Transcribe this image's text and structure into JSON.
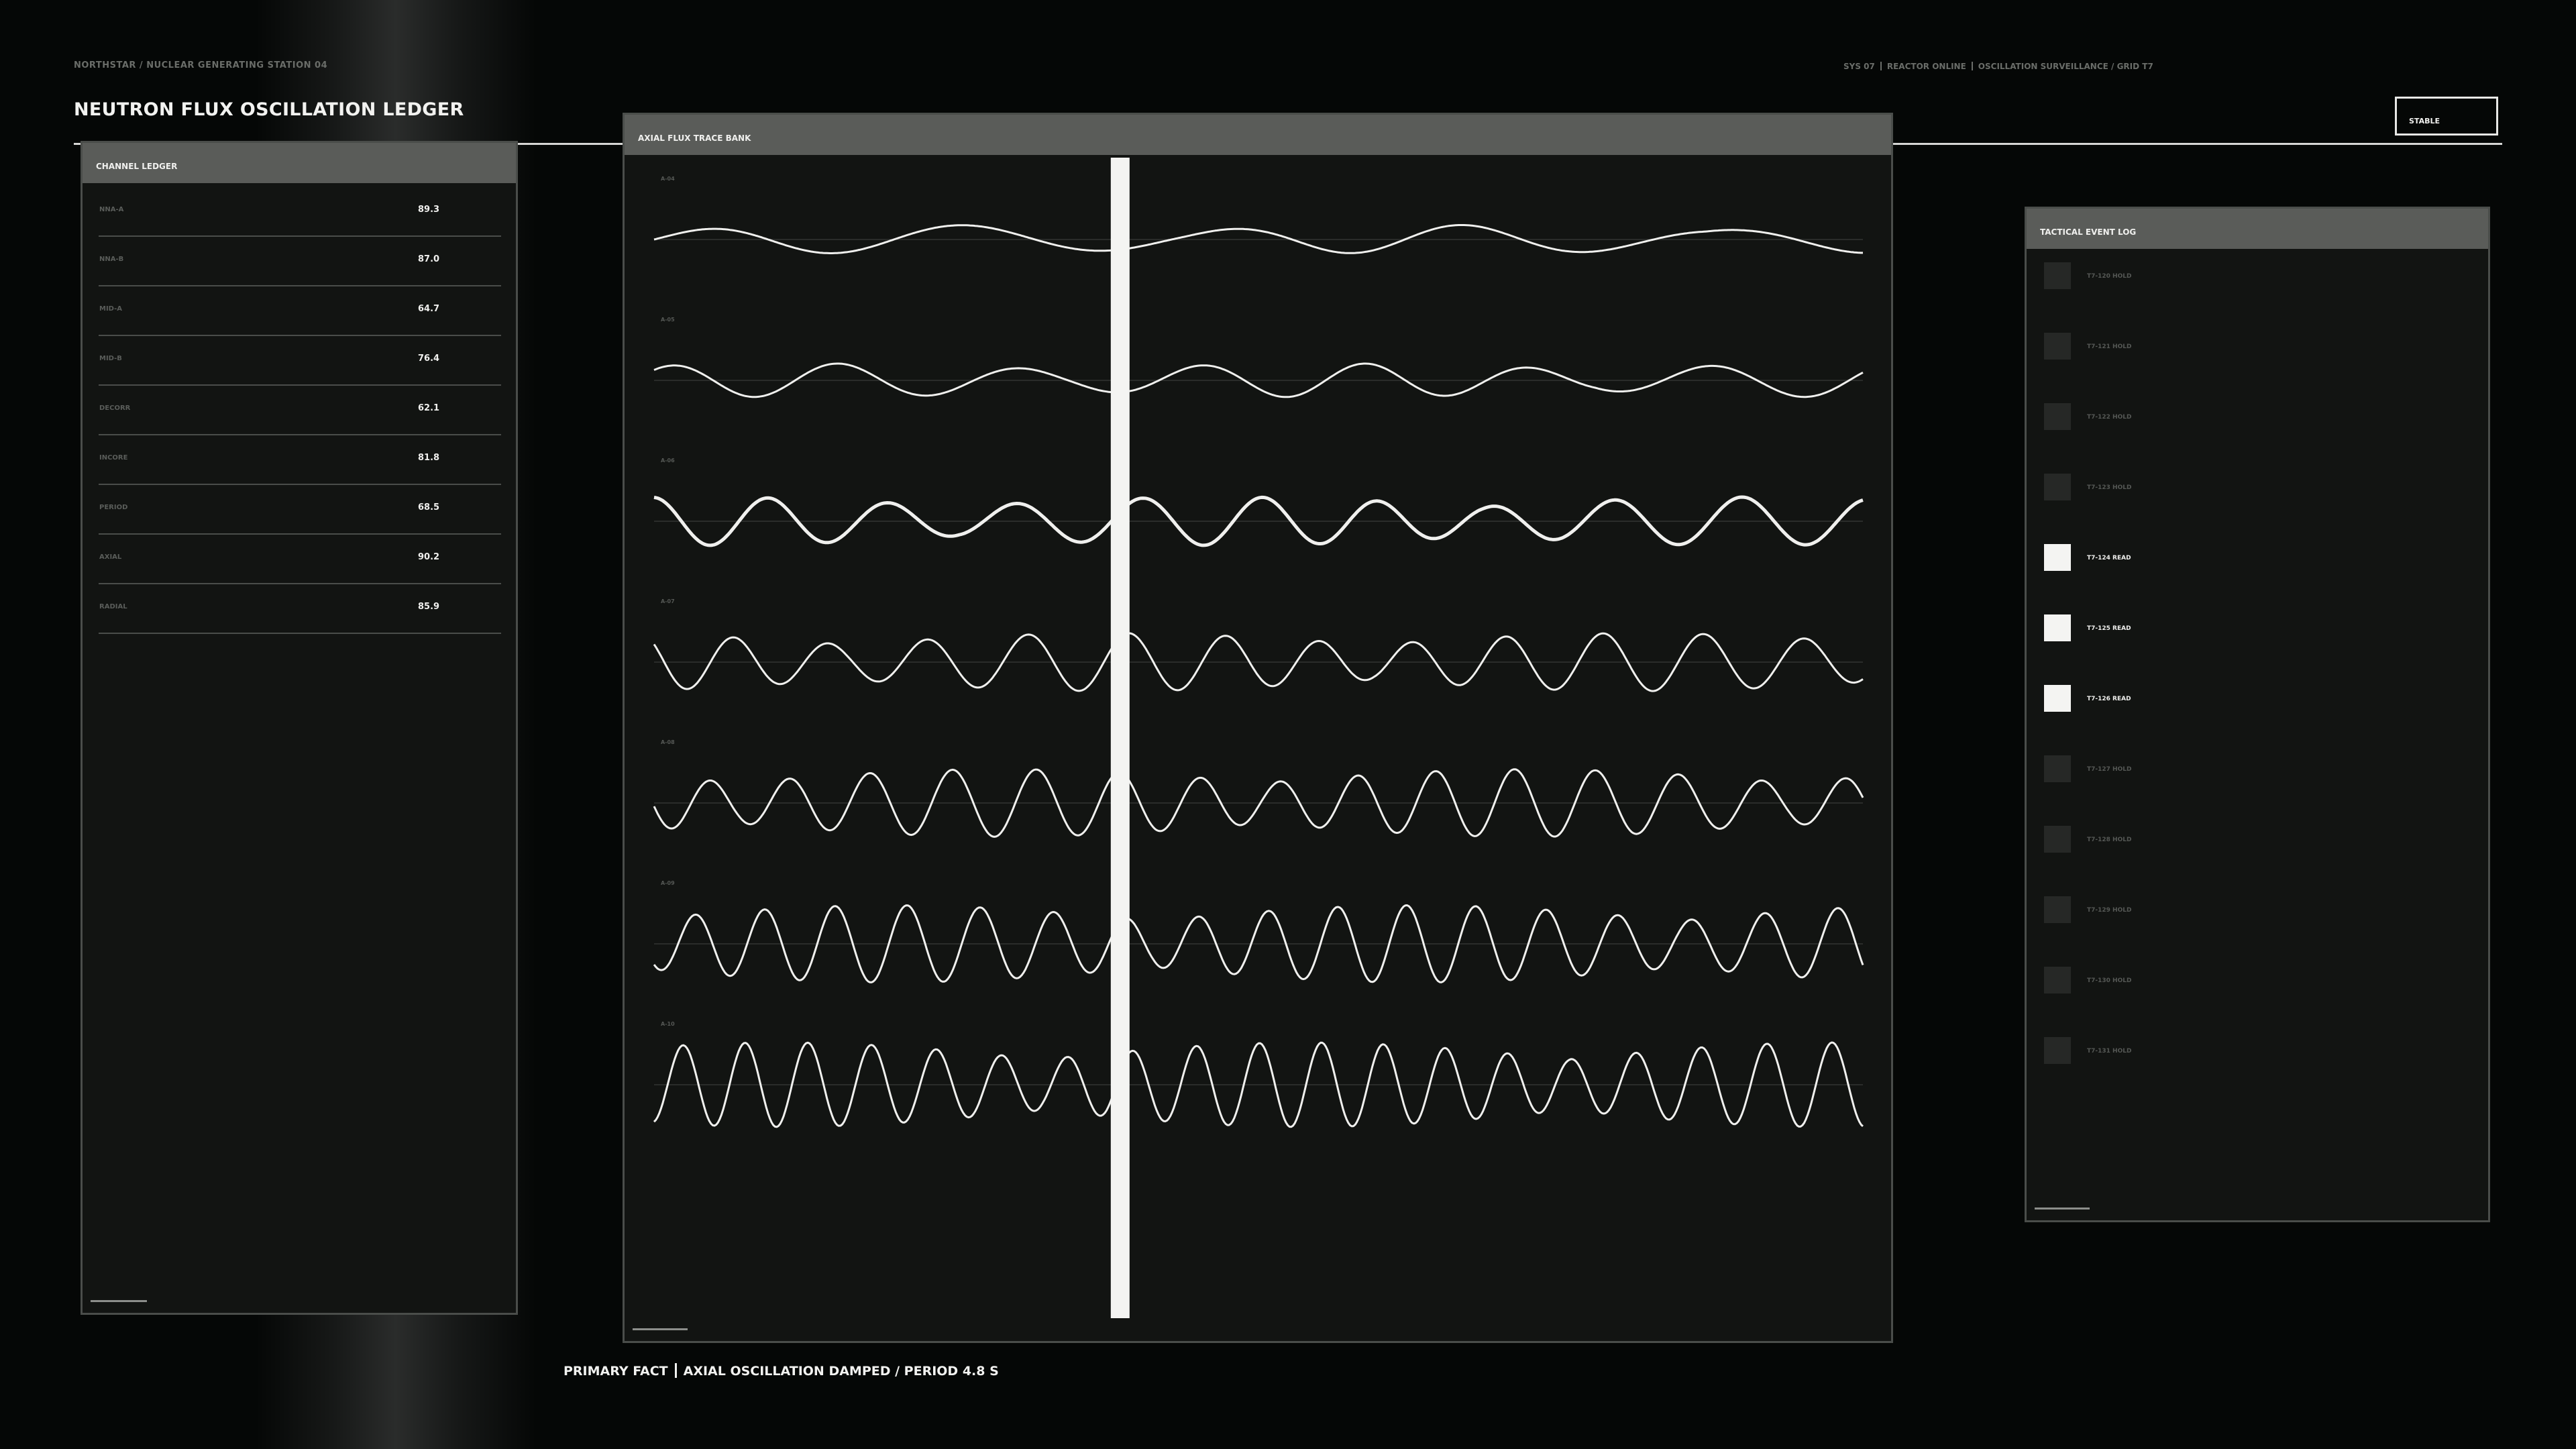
{
  "header": {
    "breadcrumb": "NORTHSTAR / NUCLEAR GENERATING STATION 04",
    "title": "NEUTRON FLUX OSCILLATION LEDGER",
    "sys": "SYS 07",
    "reactor": "REACTOR ONLINE",
    "surveillance": "OSCILLATION SURVEILLANCE / GRID T7",
    "status": "STABLE"
  },
  "ledger": {
    "title": "CHANNEL LEDGER",
    "rows": [
      {
        "name": "NNA-A",
        "value": "89.3"
      },
      {
        "name": "NNA-B",
        "value": "87.0"
      },
      {
        "name": "MID-A",
        "value": "64.7"
      },
      {
        "name": "MID-B",
        "value": "76.4"
      },
      {
        "name": "DECORR",
        "value": "62.1"
      },
      {
        "name": "INCORE",
        "value": "81.8"
      },
      {
        "name": "PERIOD",
        "value": "68.5"
      },
      {
        "name": "AXIAL",
        "value": "90.2"
      },
      {
        "name": "RADIAL",
        "value": "85.9"
      }
    ]
  },
  "tracebank": {
    "title": "AXIAL FLUX TRACE BANK",
    "cursor_position": 0.385,
    "traces": [
      {
        "label": "A-04",
        "amplitude": 0.24,
        "cycles": 4.8,
        "bold": false
      },
      {
        "label": "A-05",
        "amplitude": 0.28,
        "cycles": 7,
        "bold": false
      },
      {
        "label": "A-06",
        "amplitude": 0.4,
        "cycles": 10,
        "bold": true
      },
      {
        "label": "A-07",
        "amplitude": 0.48,
        "cycles": 12.5,
        "bold": false
      },
      {
        "label": "A-08",
        "amplitude": 0.56,
        "cycles": 15,
        "bold": false
      },
      {
        "label": "A-09",
        "amplitude": 0.64,
        "cycles": 17,
        "bold": false
      },
      {
        "label": "A-10",
        "amplitude": 0.7,
        "cycles": 19,
        "bold": false
      }
    ]
  },
  "eventlog": {
    "title": "TACTICAL EVENT LOG",
    "events": [
      {
        "label": "T7-120  HOLD",
        "active": false
      },
      {
        "label": "T7-121  HOLD",
        "active": false
      },
      {
        "label": "T7-122  HOLD",
        "active": false
      },
      {
        "label": "T7-123  HOLD",
        "active": false
      },
      {
        "label": "T7-124  READ",
        "active": true
      },
      {
        "label": "T7-125  READ",
        "active": true
      },
      {
        "label": "T7-126  READ",
        "active": true
      },
      {
        "label": "T7-127  HOLD",
        "active": false
      },
      {
        "label": "T7-128  HOLD",
        "active": false
      },
      {
        "label": "T7-129  HOLD",
        "active": false
      },
      {
        "label": "T7-130  HOLD",
        "active": false
      },
      {
        "label": "T7-131  HOLD",
        "active": false
      }
    ]
  },
  "footer": {
    "fact_label": "PRIMARY FACT",
    "fact_text": "AXIAL OSCILLATION DAMPED / PERIOD 4.8 S"
  },
  "colors": {
    "background": "#050706",
    "panel": "#121412",
    "panel_header": "#5a5c59",
    "accent": "#f4f4f2"
  }
}
